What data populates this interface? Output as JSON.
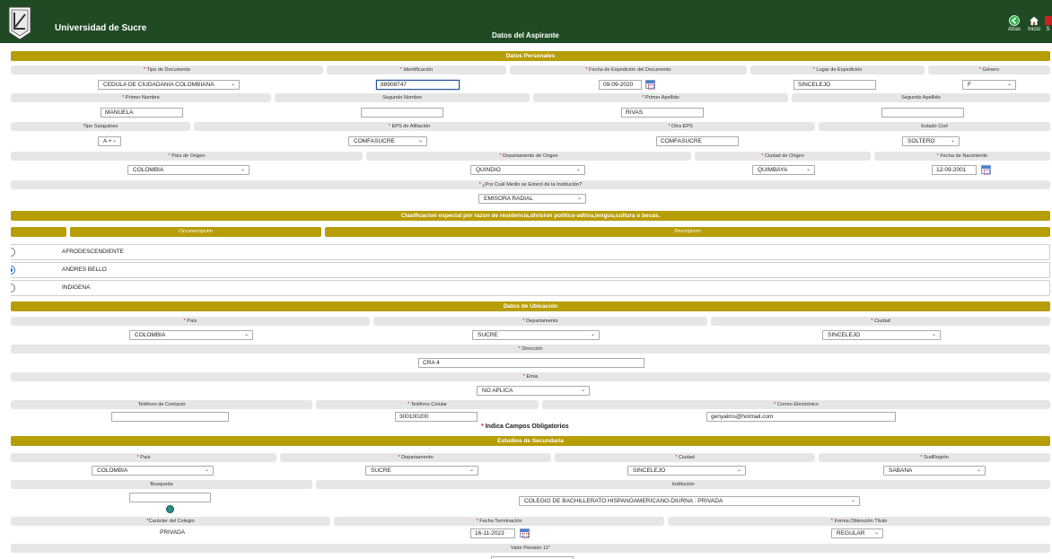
{
  "header": {
    "university": "Universidad de Sucre",
    "title": "Datos del Aspirante",
    "back": "Atras",
    "home": "Inicio",
    "exit": "S"
  },
  "personal": {
    "section": "Datos Personales",
    "l_tipo_doc": "Tipo de Documento",
    "l_identificacion": "Identificación",
    "l_fecha_exp": "Fecha de Expedición del Documento",
    "l_lugar_exp": "Lugar de Expedición",
    "l_genero": "Género",
    "tipo_doc": "CEDULA DE CIUDADANIA COLOMBIANA",
    "identificacion": "88908747",
    "fecha_exp": "09-09-2020",
    "lugar_exp": "SINCELEJO",
    "genero": "F",
    "l_primer_nombre": "Primer Nombre",
    "l_segundo_nombre": "Segundo Nombre",
    "l_primer_apellido": "Primer Apellido",
    "l_segundo_apellido": "Segundo Apellido",
    "primer_nombre": "MANUELA",
    "segundo_nombre": "",
    "primer_apellido": "RIVAS",
    "segundo_apellido": "",
    "l_tipo_sanguineo": "Tipo Sanguineo",
    "l_eps": "EPS de Afiliación",
    "l_otra_eps": "Otra EPS",
    "l_estado_civil": "Estado Civil",
    "tipo_sanguineo": "A +",
    "eps": "COMFASUCRE",
    "otra_eps": "COMFASUCRE",
    "estado_civil": "SOLTERO",
    "l_pais_origen": "País de Origen",
    "l_depto_origen": "Departamento de Origen",
    "l_ciudad_origen": "Ciudad de Origen",
    "l_fecha_nac": "Fecha de Nacimiento",
    "pais_origen": "COLOMBIA",
    "depto_origen": "QUINDIO",
    "ciudad_origen": "QUIMBAYA",
    "fecha_nac": "12-09-2001",
    "l_medio": "¿Por Cuál Medio se Enteró de la Institución?",
    "medio": "EMISORA RADIAL"
  },
  "clasificacion": {
    "section": "Clasificacion especial por razon de residencia,division politico-adtiva,lengua,cultura o becas.",
    "col1": "Circunscripcion",
    "col2": "Descripcion",
    "rows": [
      {
        "label": "AFRODESCENDIENTE",
        "selected": false
      },
      {
        "label": "ANDRES BELLO",
        "selected": true
      },
      {
        "label": "INDIGENA",
        "selected": false
      }
    ]
  },
  "ubicacion": {
    "section": "Datos de Ubicación",
    "l_pais": "País",
    "l_depto": "Departamento",
    "l_ciudad": "Ciudad",
    "pais": "COLOMBIA",
    "depto": "SUCRE",
    "ciudad": "SINCELEJO",
    "l_direccion": "Dirección",
    "direccion": "CRA 4",
    "l_etnia": "Etnia",
    "etnia": "NO APLICA",
    "l_tel_contacto": "Teléfono de Contacto",
    "l_tel_celular": "Teléfono Celular",
    "l_correo": "Correo Electrónico",
    "tel_contacto": "",
    "tel_celular": "300100200",
    "correo": "genyalms@hotmail.com",
    "required_note": "Indica Campos Obligatorios"
  },
  "secundaria": {
    "section": "Estudios de Secundaria",
    "l_pais": "País",
    "l_depto": "Departamento",
    "l_ciudad": "Ciudad",
    "l_subregion": "SudRegión",
    "pais": "COLOMBIA",
    "depto": "SUCRE",
    "ciudad": "SINCELEJO",
    "subregion": "SABANA",
    "l_busqueda": "Busqueda",
    "l_institucion": "Institución",
    "busqueda": "",
    "institucion": "COLEGIO DE BACHILLERATO HISPANOAMERICANO-DIURNA : PRIVADA",
    "l_caracter": "*Carácter del Colegio",
    "l_fecha_term": "Fecha Terminación",
    "l_forma": "Forma Obtención Título",
    "caracter": "PRIVADA",
    "fecha_term": "16-11-2023",
    "forma": "REGULAR",
    "l_pension": "Valor Pensión 11*"
  },
  "colors": {
    "header_bg": "#1f4a24",
    "section_bg": "#b79d07",
    "label_bg": "#e6e6e6",
    "required": "#d11111"
  }
}
